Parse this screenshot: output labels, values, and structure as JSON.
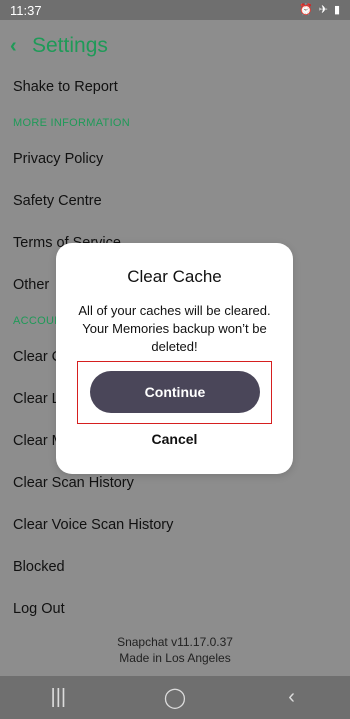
{
  "status_bar": {
    "time": "11:37",
    "icons": [
      "alarm-icon",
      "airplane-icon",
      "battery-icon"
    ]
  },
  "header": {
    "back_icon": "chevron-left-icon",
    "title": "Settings"
  },
  "settings": {
    "rows": [
      {
        "type": "item",
        "label": "Shake to Report"
      },
      {
        "type": "section",
        "label": "MORE INFORMATION"
      },
      {
        "type": "item",
        "label": "Privacy Policy"
      },
      {
        "type": "item",
        "label": "Safety Centre"
      },
      {
        "type": "item",
        "label": "Terms of Service"
      },
      {
        "type": "item",
        "label": "Other"
      },
      {
        "type": "section",
        "label": "ACCOUNT ACTIONS"
      },
      {
        "type": "item",
        "label": "Clear Cache"
      },
      {
        "type": "item",
        "label": "Clear Lenses Data"
      },
      {
        "type": "item",
        "label": "Clear My Data"
      },
      {
        "type": "item",
        "label": "Clear Scan History"
      },
      {
        "type": "item",
        "label": "Clear Voice Scan History"
      },
      {
        "type": "item",
        "label": "Blocked"
      },
      {
        "type": "item",
        "label": "Log Out"
      }
    ]
  },
  "footer": {
    "version": "Snapchat v11.17.0.37",
    "made_in": "Made in Los Angeles"
  },
  "dialog": {
    "title": "Clear Cache",
    "message": "All of your caches will be cleared. Your Memories backup won’t be deleted!",
    "continue_label": "Continue",
    "cancel_label": "Cancel"
  },
  "nav": {
    "icons": [
      "recent-apps-icon",
      "home-icon",
      "back-icon"
    ]
  },
  "colors": {
    "accent": "#1f9a58",
    "dim_background": "#8d8d8d",
    "button": "#4a4659",
    "highlight": "#d61f1f"
  }
}
